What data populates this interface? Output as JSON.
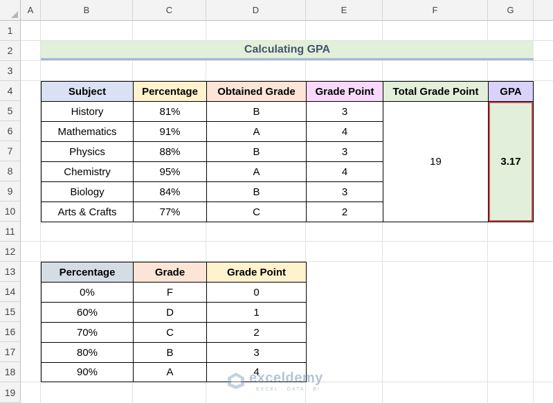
{
  "columns": [
    "A",
    "B",
    "C",
    "D",
    "E",
    "F",
    "G"
  ],
  "rows": [
    "1",
    "2",
    "3",
    "4",
    "5",
    "6",
    "7",
    "8",
    "9",
    "10",
    "11",
    "12",
    "13",
    "14",
    "15",
    "16",
    "17",
    "18",
    "19"
  ],
  "title": "Calculating GPA",
  "main_table": {
    "headers": [
      "Subject",
      "Percentage",
      "Obtained Grade",
      "Grade Point",
      "Total Grade Point",
      "GPA"
    ],
    "rows": [
      [
        "History",
        "81%",
        "B",
        "3"
      ],
      [
        "Mathematics",
        "91%",
        "A",
        "4"
      ],
      [
        "Physics",
        "88%",
        "B",
        "3"
      ],
      [
        "Chemistry",
        "95%",
        "A",
        "4"
      ],
      [
        "Biology",
        "84%",
        "B",
        "3"
      ],
      [
        "Arts & Crafts",
        "77%",
        "C",
        "2"
      ]
    ],
    "total_grade_point": "19",
    "gpa": "3.17"
  },
  "lookup_table": {
    "headers": [
      "Percentage",
      "Grade",
      "Grade Point"
    ],
    "rows": [
      [
        "0%",
        "F",
        "0"
      ],
      [
        "60%",
        "D",
        "1"
      ],
      [
        "70%",
        "C",
        "2"
      ],
      [
        "80%",
        "B",
        "3"
      ],
      [
        "90%",
        "A",
        "4"
      ]
    ]
  },
  "watermark": {
    "name": "exceldemy",
    "tagline": "EXCEL · DATA · BI"
  },
  "colors": {
    "title_bg": "#e2efda",
    "gpa_outline": "#d14d4d"
  }
}
